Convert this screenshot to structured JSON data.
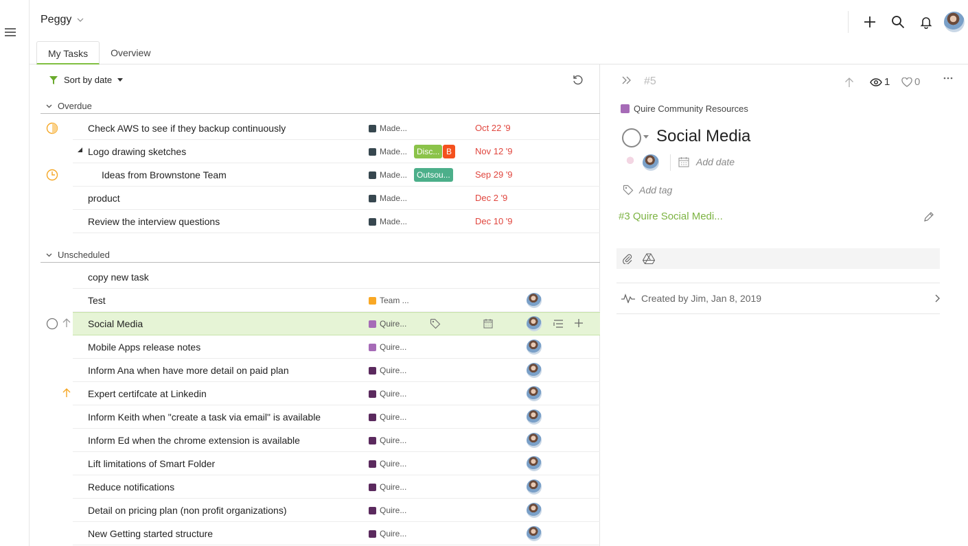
{
  "workspace": {
    "name": "Peggy"
  },
  "tabs": [
    {
      "label": "My Tasks",
      "active": true
    },
    {
      "label": "Overview",
      "active": false
    }
  ],
  "toolbar": {
    "sort_label": "Sort by date"
  },
  "sections": {
    "overdue": {
      "label": "Overdue"
    },
    "unscheduled": {
      "label": "Unscheduled"
    }
  },
  "overdue_tasks": [
    {
      "name": "Check AWS to see if they backup continuously",
      "project": "Made...",
      "project_color": "#37474f",
      "date": "Oct 22 '9",
      "status_icon": "partial-progress-icon"
    },
    {
      "name": "Logo drawing sketches",
      "project": "Made...",
      "project_color": "#37474f",
      "date": "Nov 12 '9",
      "tags": [
        {
          "label": "Disc...",
          "color": "#8bc34a"
        },
        {
          "label": "B",
          "color": "#f4511e"
        }
      ],
      "expanded": true
    },
    {
      "name": "Ideas from Brownstone Team",
      "project": "Made...",
      "project_color": "#37474f",
      "date": "Sep 29 '9",
      "tags": [
        {
          "label": "Outsou...",
          "color": "#4caf8a"
        }
      ],
      "status_icon": "in-progress-icon",
      "subtask": true
    },
    {
      "name": "product",
      "project": "Made...",
      "project_color": "#37474f",
      "date": "Dec 2 '9"
    },
    {
      "name": "Review the interview questions",
      "project": "Made...",
      "project_color": "#37474f",
      "date": "Dec 10 '9"
    }
  ],
  "unscheduled_tasks": [
    {
      "name": "copy new task",
      "project": "",
      "project_color": ""
    },
    {
      "name": "Test",
      "project": "Team ...",
      "project_color": "#f9a825",
      "assignee": true
    },
    {
      "name": "Social Media",
      "project": "Quire...",
      "project_color": "#a66bb7",
      "assignee": true,
      "selected": true
    },
    {
      "name": "Mobile Apps release notes",
      "project": "Quire...",
      "project_color": "#a66bb7",
      "assignee": true
    },
    {
      "name": "Inform Ana when have more detail on paid plan",
      "project": "Quire...",
      "project_color": "#5b2a5e",
      "assignee": true
    },
    {
      "name": "Expert certifcate at Linkedin",
      "project": "Quire...",
      "project_color": "#5b2a5e",
      "assignee": true,
      "priority_up": true
    },
    {
      "name": "Inform Keith when \"create a task via email\" is available",
      "project": "Quire...",
      "project_color": "#5b2a5e",
      "assignee": true
    },
    {
      "name": "Inform Ed when the chrome extension is available",
      "project": "Quire...",
      "project_color": "#5b2a5e",
      "assignee": true
    },
    {
      "name": "Lift limitations of Smart Folder",
      "project": "Quire...",
      "project_color": "#5b2a5e",
      "assignee": true
    },
    {
      "name": "Reduce notifications",
      "project": "Quire...",
      "project_color": "#5b2a5e",
      "assignee": true
    },
    {
      "name": "Detail on pricing plan (non profit organizations)",
      "project": "Quire...",
      "project_color": "#5b2a5e",
      "assignee": true
    },
    {
      "name": "New Getting started structure",
      "project": "Quire...",
      "project_color": "#5b2a5e",
      "assignee": true
    }
  ],
  "detail": {
    "task_number": "#5",
    "watchers": "1",
    "likes": "0",
    "project": "Quire Community Resources",
    "title": "Social Media",
    "add_date": "Add date",
    "add_tag": "Add tag",
    "parent": "#3 Quire Social Medi...",
    "activity": "Created by Jim, Jan 8, 2019"
  },
  "colors": {
    "accent": "#7cb342",
    "overdue": "#e0453d",
    "selected_row": "#e6f4d6"
  }
}
